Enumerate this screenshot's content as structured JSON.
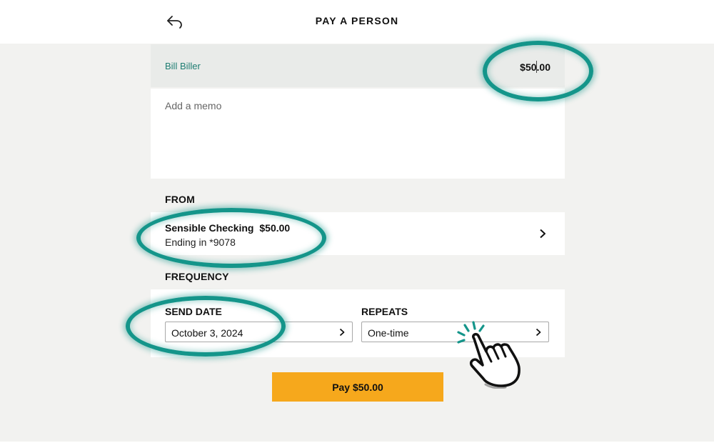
{
  "header": {
    "title": "PAY A PERSON",
    "back_icon": "back-arrow-icon"
  },
  "payee": {
    "name": "Bill Biller",
    "amount_before_cursor": "$50",
    "amount_after_cursor": ".00"
  },
  "memo": {
    "placeholder": "Add a memo",
    "value": ""
  },
  "from": {
    "label": "FROM",
    "account_name": "Sensible Checking",
    "account_amount": "$50.00",
    "account_ending": "Ending in *9078",
    "chevron_icon": "chevron-right-icon"
  },
  "frequency": {
    "label": "FREQUENCY",
    "send_date_label": "SEND DATE",
    "send_date_value": "October 3, 2024",
    "repeats_label": "REPEATS",
    "repeats_value": "One-time"
  },
  "pay_button": {
    "label": "Pay $50.00",
    "color": "#f6a81c"
  },
  "colors": {
    "accent_teal": "#14958a",
    "payee_text": "#1e7d72",
    "background": "#f2f2f0"
  }
}
